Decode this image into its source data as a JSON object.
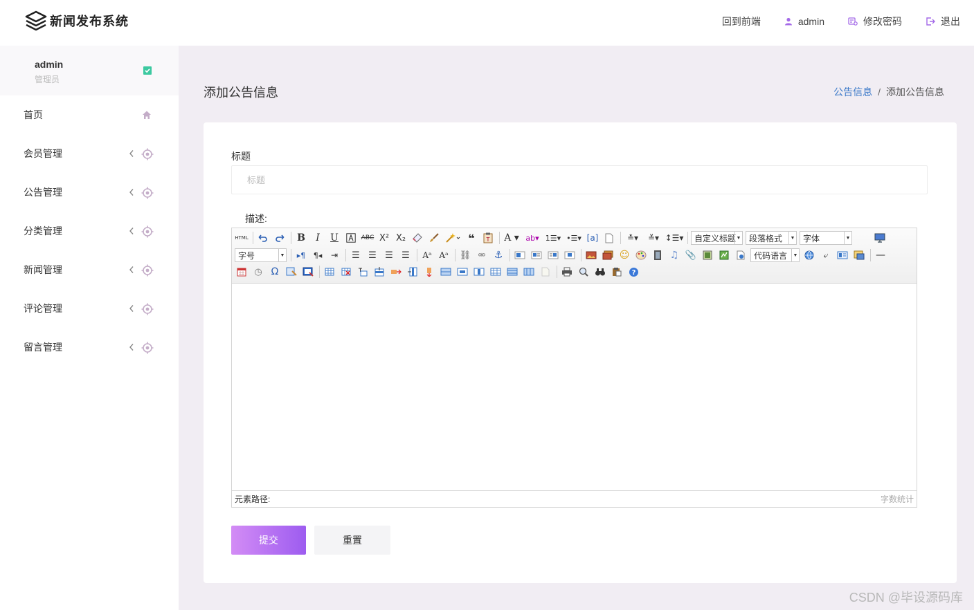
{
  "app": {
    "title": "新闻发布系统"
  },
  "topnav": {
    "frontend": "回到前端",
    "user": "admin",
    "change_password": "修改密码",
    "logout": "退出"
  },
  "sidebar": {
    "user": {
      "name": "admin",
      "role": "管理员"
    },
    "items": [
      {
        "label": "首页",
        "icon": "home-icon"
      },
      {
        "label": "会员管理",
        "icon": "target-icon"
      },
      {
        "label": "公告管理",
        "icon": "target-icon"
      },
      {
        "label": "分类管理",
        "icon": "target-icon"
      },
      {
        "label": "新闻管理",
        "icon": "target-icon"
      },
      {
        "label": "评论管理",
        "icon": "target-icon"
      },
      {
        "label": "留言管理",
        "icon": "target-icon"
      }
    ]
  },
  "page": {
    "title": "添加公告信息",
    "breadcrumb": {
      "parent": "公告信息",
      "sep": "/",
      "current": "添加公告信息"
    }
  },
  "form": {
    "title_label": "标题",
    "title_placeholder": "标题",
    "title_value": "",
    "desc_label": "描述:",
    "editor": {
      "toolbar": {
        "html": "HTML",
        "custom_title": "自定义标题",
        "paragraph": "段落格式",
        "font": "字体",
        "font_size": "字号",
        "code_lang": "代码语言"
      },
      "status_path": "元素路径:",
      "status_count": "字数统计"
    },
    "submit_label": "提交",
    "reset_label": "重置"
  },
  "watermark": "CSDN @毕设源码库",
  "colors": {
    "accent": "#9d5cf0",
    "accent_light": "#d38cf5",
    "link": "#3a78c8",
    "background": "#f1edf3",
    "badge": "#3cc9a0"
  }
}
